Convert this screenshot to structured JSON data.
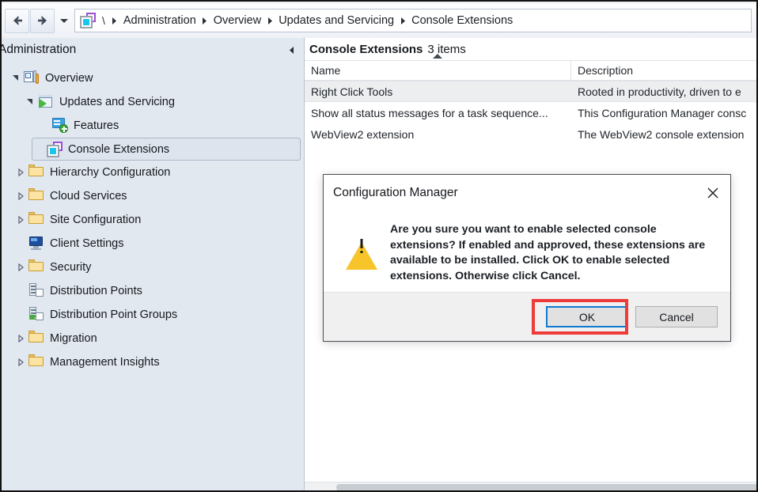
{
  "navbar": {
    "back_icon": "arrow-left-icon",
    "forward_icon": "arrow-right-icon",
    "history_dropdown_icon": "chevron-down-icon",
    "address_icon": "console-extension-icon",
    "root_label": "\\",
    "breadcrumbs": [
      "Administration",
      "Overview",
      "Updates and Servicing",
      "Console Extensions"
    ],
    "separator_icon": "chevron-right-icon"
  },
  "sidebar": {
    "title": "Administration",
    "collapse_icon": "chevron-left-icon",
    "items": [
      {
        "label": "Overview",
        "icon": "overview-icon",
        "indent": 0,
        "twisty": "expanded",
        "selected": false
      },
      {
        "label": "Updates and Servicing",
        "icon": "updates-servicing-icon",
        "indent": 1,
        "twisty": "expanded",
        "selected": false
      },
      {
        "label": "Features",
        "icon": "features-icon",
        "indent": 2,
        "twisty": "none",
        "selected": false
      },
      {
        "label": "Console Extensions",
        "icon": "console-extension-icon",
        "indent": 2,
        "twisty": "none",
        "selected": true
      },
      {
        "label": "Hierarchy Configuration",
        "icon": "folder-icon",
        "indent": 1,
        "twisty": "collapsed",
        "selected": false
      },
      {
        "label": "Cloud Services",
        "icon": "folder-icon",
        "indent": 1,
        "twisty": "collapsed",
        "selected": false
      },
      {
        "label": "Site Configuration",
        "icon": "folder-icon",
        "indent": 1,
        "twisty": "collapsed",
        "selected": false
      },
      {
        "label": "Client Settings",
        "icon": "monitor-icon",
        "indent": 1,
        "twisty": "none",
        "selected": false
      },
      {
        "label": "Security",
        "icon": "folder-icon",
        "indent": 1,
        "twisty": "collapsed",
        "selected": false
      },
      {
        "label": "Distribution Points",
        "icon": "distribution-point-icon",
        "indent": 1,
        "twisty": "none",
        "selected": false
      },
      {
        "label": "Distribution Point Groups",
        "icon": "distribution-point-group-icon",
        "indent": 1,
        "twisty": "none",
        "selected": false
      },
      {
        "label": "Migration",
        "icon": "folder-icon",
        "indent": 1,
        "twisty": "collapsed",
        "selected": false
      },
      {
        "label": "Management Insights",
        "icon": "folder-icon",
        "indent": 1,
        "twisty": "collapsed",
        "selected": false
      }
    ]
  },
  "main": {
    "list_title": "Console Extensions",
    "item_count": "3 items",
    "sort_indicator_icon": "sort-ascending-icon",
    "columns": [
      "Name",
      "Description"
    ],
    "rows": [
      {
        "name": "Right Click Tools",
        "description": "Rooted in productivity, driven to e",
        "selected": true
      },
      {
        "name": "Show all status messages for a task sequence...",
        "description": "This Configuration Manager consc",
        "selected": false
      },
      {
        "name": "WebView2 extension",
        "description": "The WebView2 console extension",
        "selected": false
      }
    ]
  },
  "dialog": {
    "title": "Configuration Manager",
    "close_icon": "close-icon",
    "warning_icon": "warning-triangle-icon",
    "message": "Are you sure you want to enable selected console extensions? If enabled and approved, these extensions are available to be installed. Click OK to enable selected extensions. Otherwise click Cancel.",
    "ok_label": "OK",
    "cancel_label": "Cancel"
  },
  "annotation": {
    "highlight_color": "#ef3a3a",
    "target": "ok-button"
  },
  "colors": {
    "sidebar_bg": "#e2e8f0",
    "selection_bg": "#edeef0",
    "focus_border": "#0f7ad0",
    "warning_yellow": "#f7c42a",
    "accent_cyan": "#18c6f0",
    "accent_purple": "#9b4fd8"
  }
}
